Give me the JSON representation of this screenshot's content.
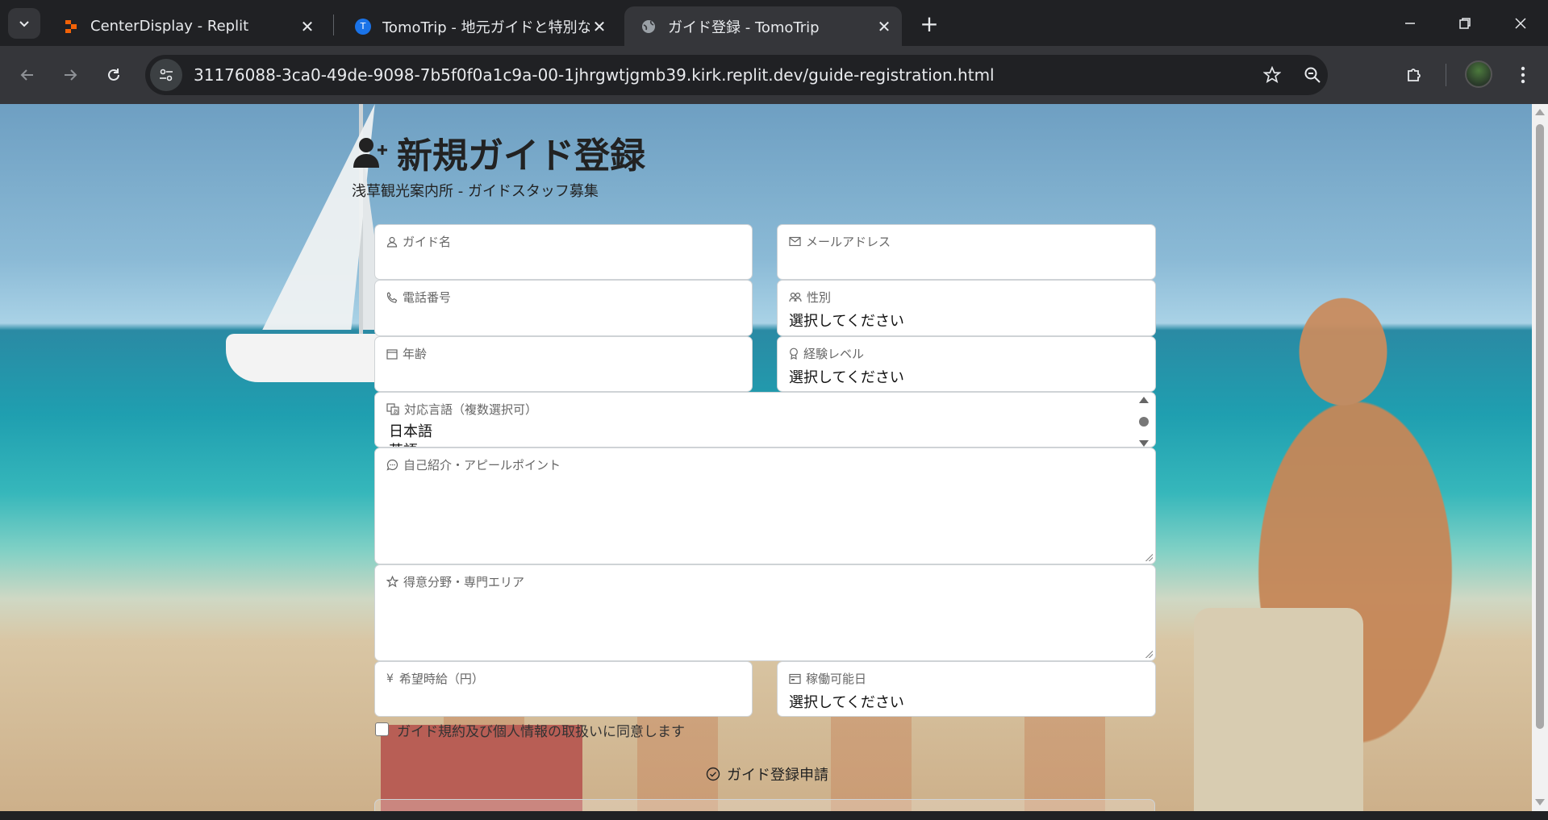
{
  "browser": {
    "tabs": [
      {
        "title": "CenterDisplay - Replit",
        "active": false
      },
      {
        "title": "TomoTrip - 地元ガイドと特別な旅",
        "active": false
      },
      {
        "title": "ガイド登録 - TomoTrip",
        "active": true
      }
    ],
    "url": "31176088-3ca0-49de-9098-7b5f0f0a1c9a-00-1jhrgwtjgmb39.kirk.replit.dev/guide-registration.html",
    "tab_favicon_letter": "T"
  },
  "page": {
    "title": "新規ガイド登録",
    "subtitle": "浅草観光案内所 - ガイドスタッフ募集",
    "fields": {
      "name": {
        "label": "ガイド名",
        "value": ""
      },
      "email": {
        "label": "メールアドレス",
        "value": ""
      },
      "phone": {
        "label": "電話番号",
        "value": ""
      },
      "gender": {
        "label": "性別",
        "value": "選択してください"
      },
      "age": {
        "label": "年齢",
        "value": ""
      },
      "experience": {
        "label": "経験レベル",
        "value": "選択してください"
      },
      "languages": {
        "label": "対応言語（複数選択可）",
        "options": [
          "日本語",
          "英語"
        ]
      },
      "intro": {
        "label": "自己紹介・アピールポイント",
        "value": ""
      },
      "specialty": {
        "label": "得意分野・専門エリア",
        "value": ""
      },
      "wage": {
        "label": "希望時給（円）",
        "symbol": "¥",
        "value": ""
      },
      "availability": {
        "label": "稼働可能日",
        "value": "選択してください"
      }
    },
    "agree_text": "ガイド規約及び個人情報の取扱いに同意します",
    "submit_label": "ガイド登録申請"
  },
  "colors": {
    "chrome_dark": "#202124",
    "chrome_toolbar": "#35363a",
    "replit_orange": "#f26207",
    "tomotrip_blue": "#1a73e8"
  }
}
